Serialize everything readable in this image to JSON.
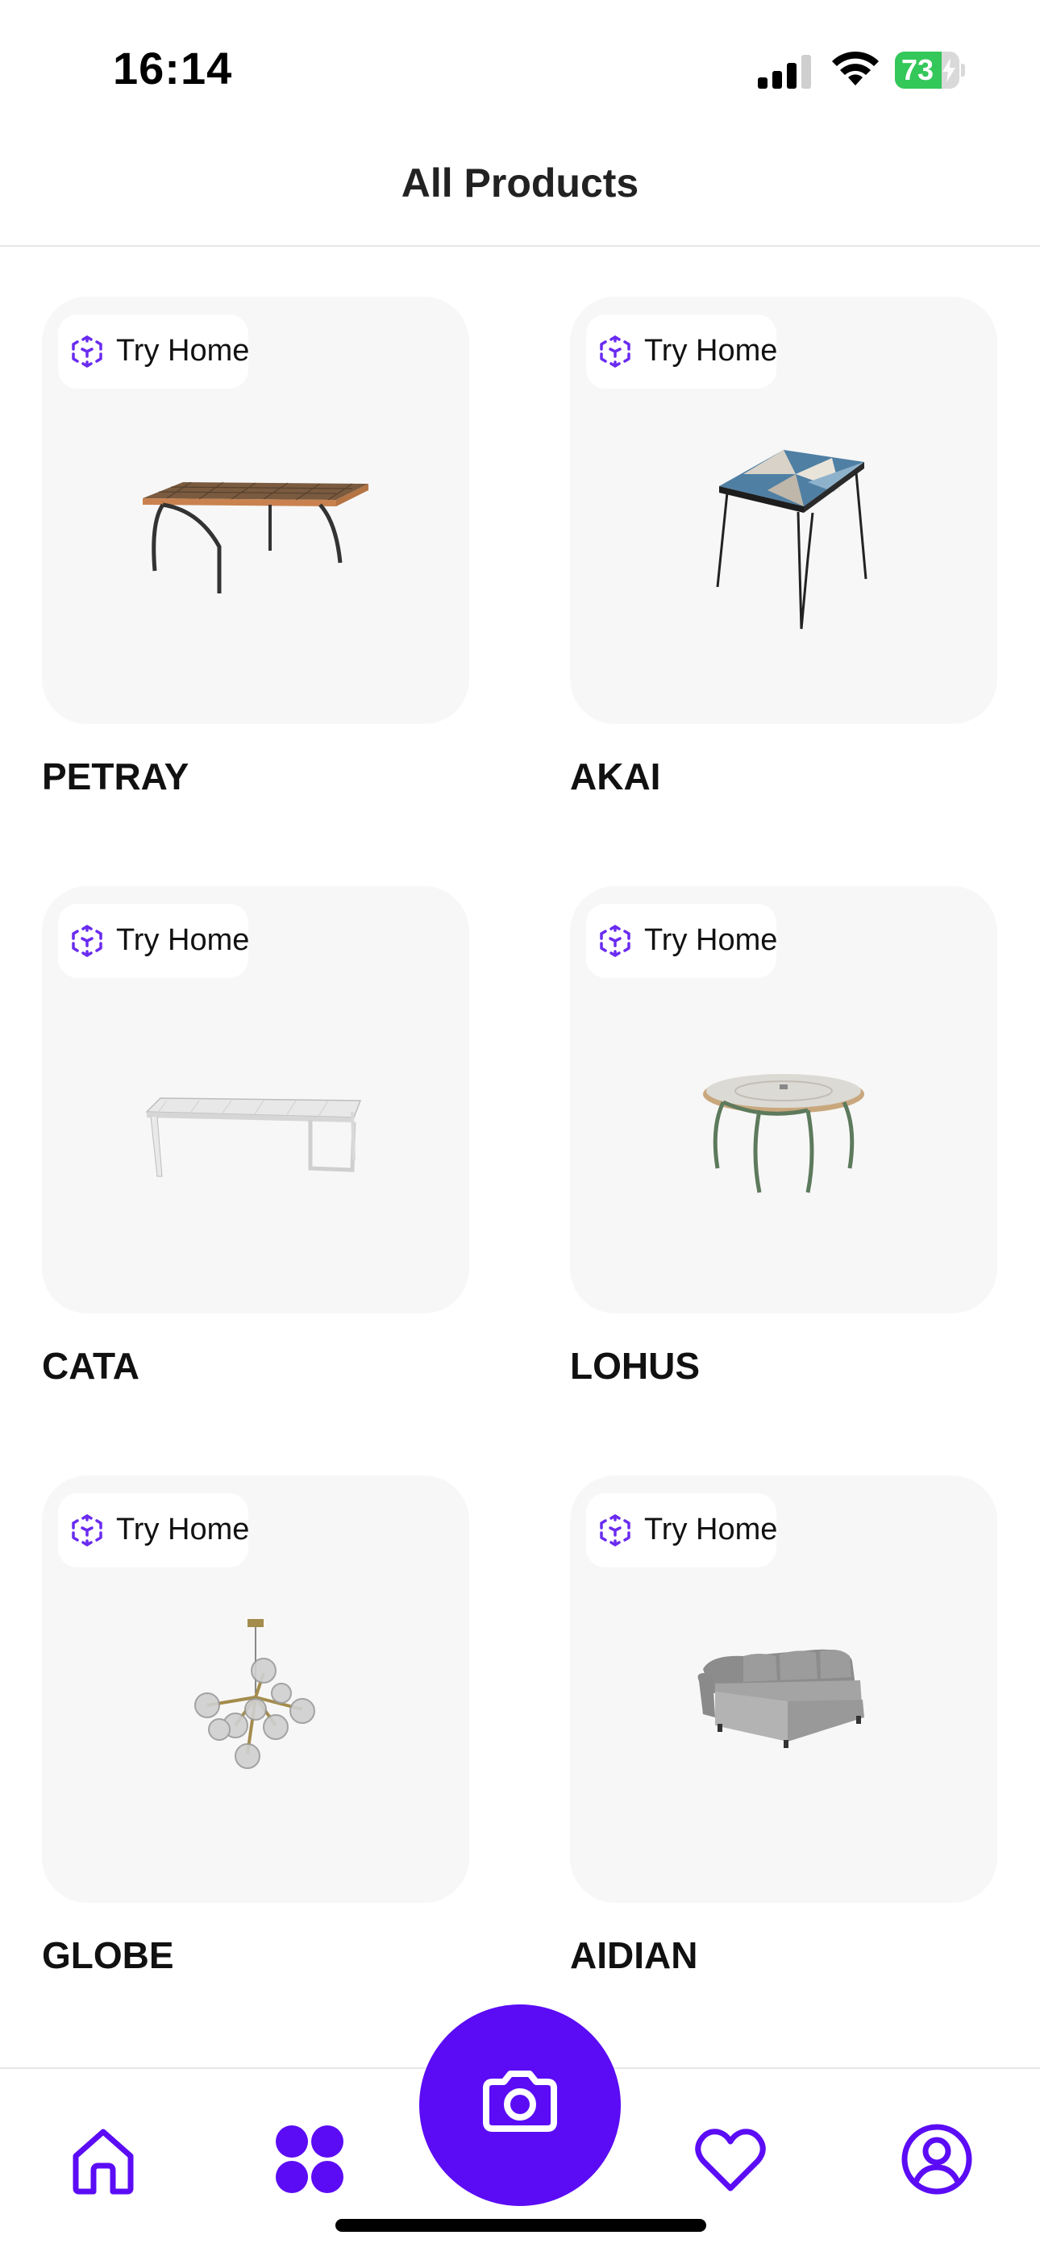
{
  "status_bar": {
    "time": "16:14",
    "battery_level": "73",
    "battery_color": "#34c759"
  },
  "header": {
    "title": "All Products"
  },
  "products": [
    {
      "name": "PETRAY",
      "try_label": "Try Home",
      "image": "rect-dining-table-wood-frame"
    },
    {
      "name": "AKAI",
      "try_label": "Try Home",
      "image": "square-tile-table-hairpin-legs"
    },
    {
      "name": "CATA",
      "try_label": "Try Home",
      "image": "white-outdoor-table"
    },
    {
      "name": "LOHUS",
      "try_label": "Try Home",
      "image": "round-bistro-table-green-legs"
    },
    {
      "name": "GLOBE",
      "try_label": "Try Home",
      "image": "glass-globe-chandelier"
    },
    {
      "name": "AIDIAN",
      "try_label": "Try Home",
      "image": "grey-corner-sofa"
    }
  ],
  "tab_bar": {
    "items": [
      {
        "icon": "home-icon"
      },
      {
        "icon": "grid-icon"
      },
      {
        "icon": "camera-icon"
      },
      {
        "icon": "heart-icon"
      },
      {
        "icon": "profile-icon"
      }
    ],
    "accent_color": "#5b0cf5"
  }
}
